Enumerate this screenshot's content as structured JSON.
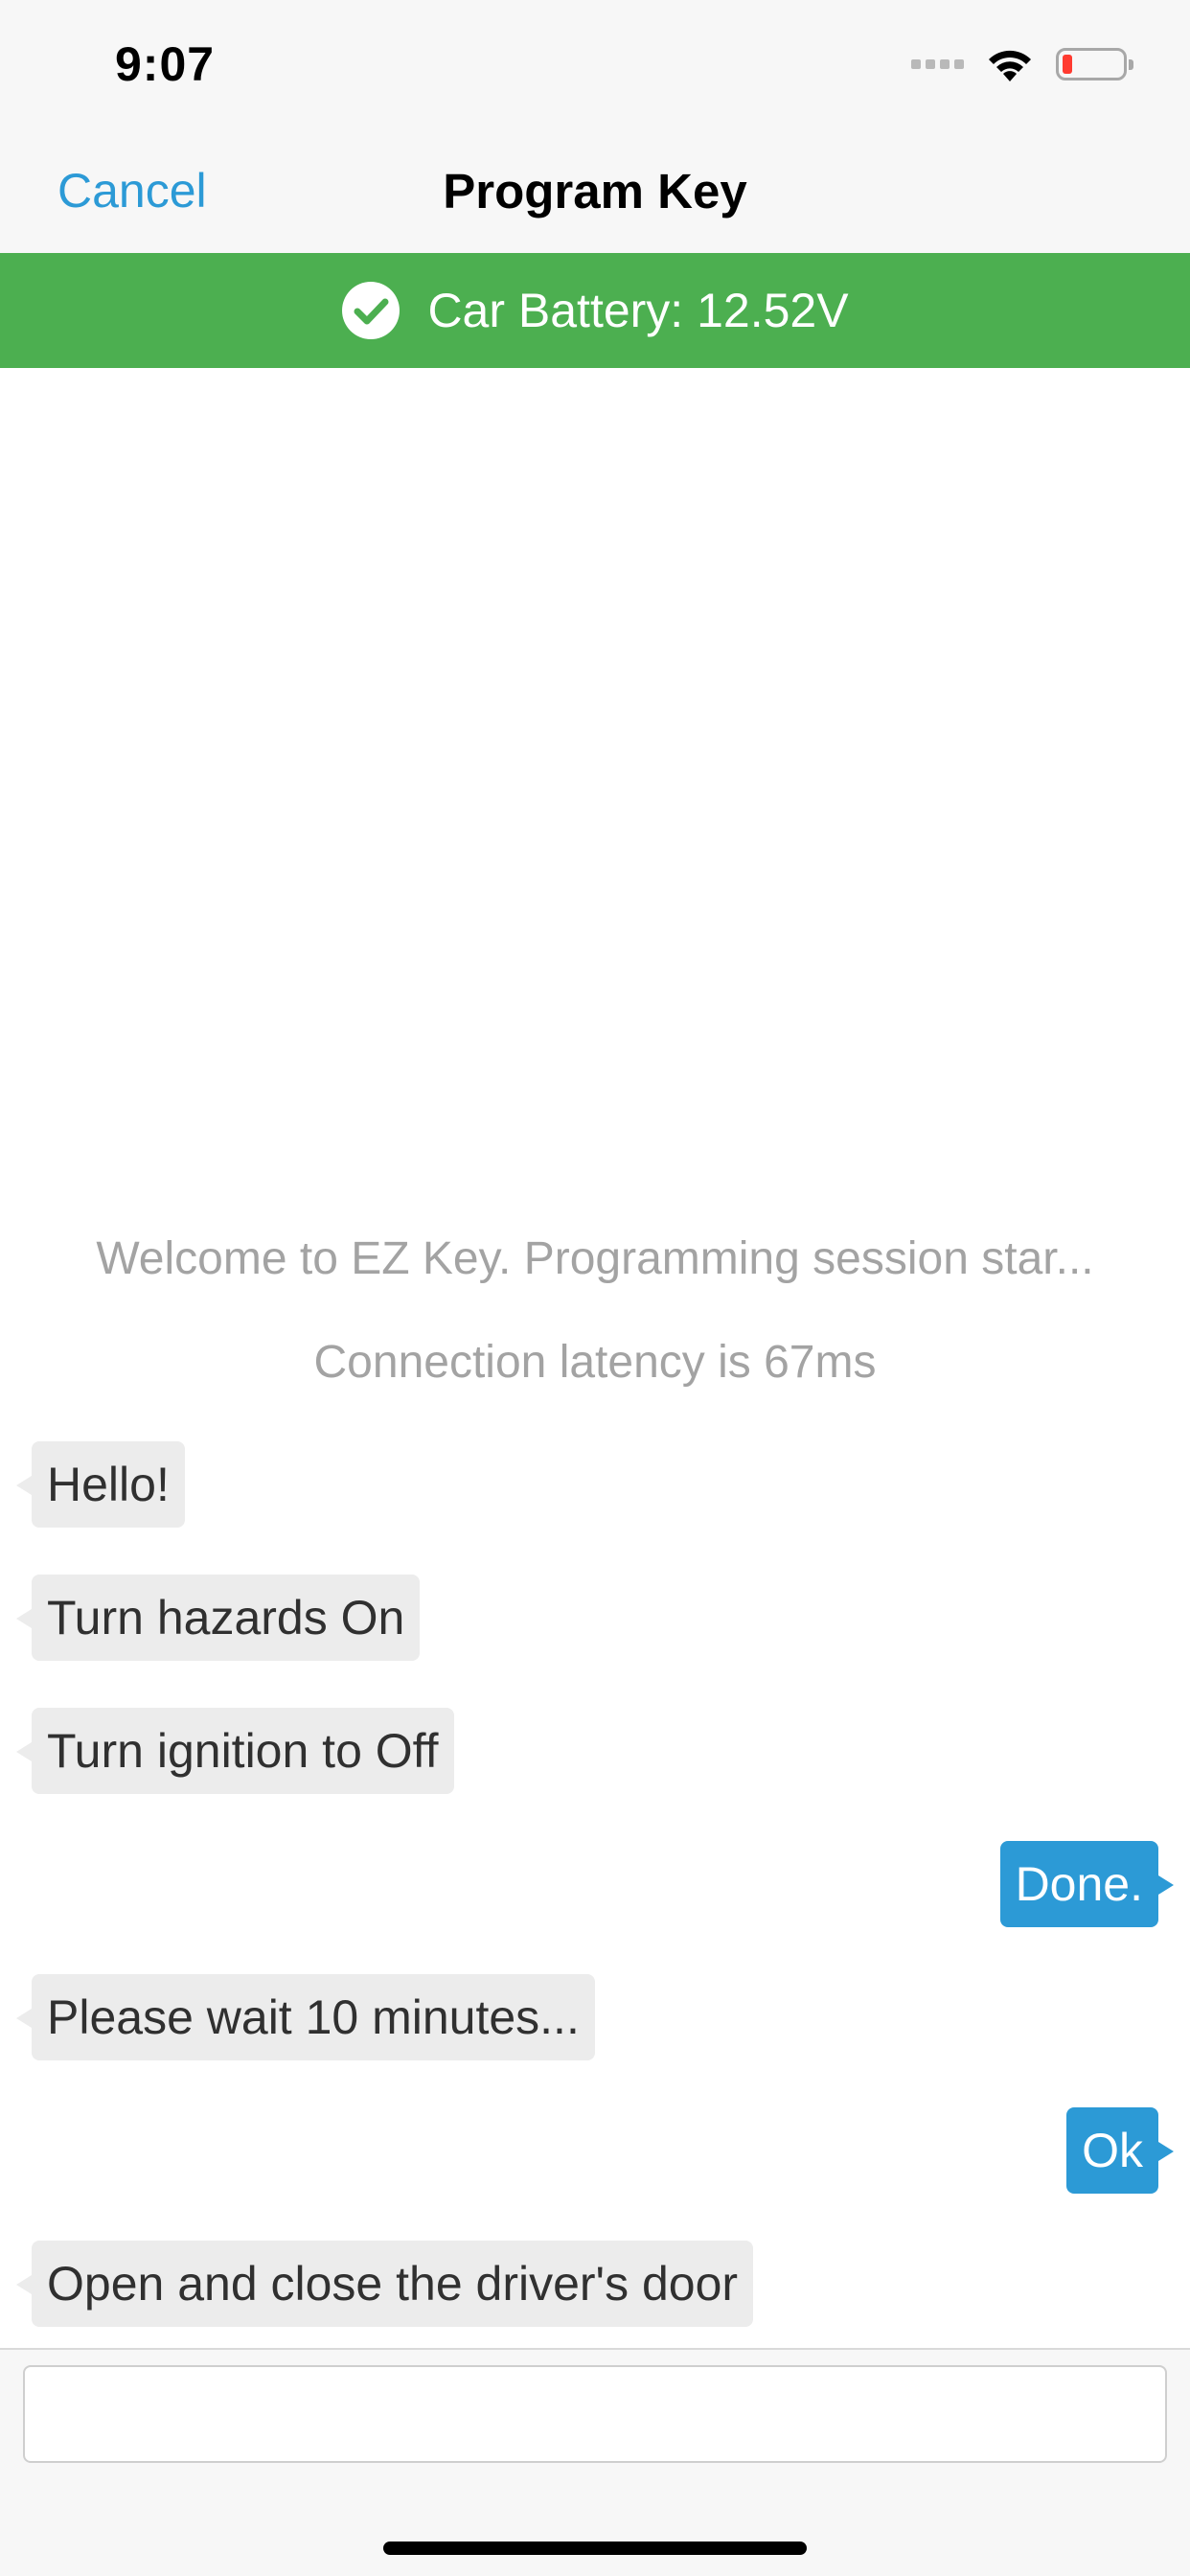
{
  "status_bar": {
    "time": "9:07",
    "icons": [
      "signal-dots-icon",
      "wifi-icon",
      "battery-low-icon"
    ],
    "battery_color": "#ff3b30"
  },
  "nav": {
    "cancel_label": "Cancel",
    "title": "Program Key"
  },
  "banner": {
    "icon": "check-circle-icon",
    "text": "Car Battery: 12.52V",
    "color": "#4caf50"
  },
  "chat": {
    "system_messages": [
      "Welcome to EZ Key. Programming session star...",
      "Connection latency is 67ms"
    ],
    "messages": [
      {
        "sender": "them",
        "text": "Hello!"
      },
      {
        "sender": "them",
        "text": "Turn hazards On"
      },
      {
        "sender": "them",
        "text": "Turn ignition to Off"
      },
      {
        "sender": "me",
        "text": "Done."
      },
      {
        "sender": "them",
        "text": "Please wait 10 minutes..."
      },
      {
        "sender": "me",
        "text": "Ok"
      },
      {
        "sender": "them",
        "text": "Open and close the driver's door"
      }
    ],
    "accent_color": "#2c9ad6",
    "incoming_bubble_color": "#ececec"
  },
  "input": {
    "value": "",
    "placeholder": ""
  }
}
